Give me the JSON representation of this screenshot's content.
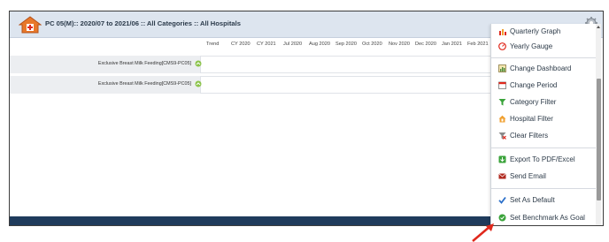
{
  "header": {
    "title": "PC 05(M):: 2020/07 to 2021/06 :: All Categories :: All Hospitals",
    "icon": "hospital-icon"
  },
  "table": {
    "columns": [
      "Trend",
      "CY 2020",
      "CY 2021",
      "Jul 2020",
      "Aug 2020",
      "Sep 2020",
      "Oct 2020",
      "Nov 2020",
      "Dec 2020",
      "Jan 2021",
      "Feb 2021"
    ],
    "rows": [
      {
        "label": "Exclusive Breast Milk Feeding[CMS9-PC05]"
      },
      {
        "label": "Exclusive Breast Milk Feeding[CMS9-PC05]"
      }
    ]
  },
  "menu": {
    "items": [
      {
        "label": "Quarterly Graph",
        "icon": "bar-chart-icon"
      },
      {
        "label": "Yearly Gauge",
        "icon": "gauge-icon"
      },
      {
        "label": "Change Dashboard",
        "icon": "dashboard-icon"
      },
      {
        "label": "Change Period",
        "icon": "calendar-icon"
      },
      {
        "label": "Category Filter",
        "icon": "filter-icon"
      },
      {
        "label": "Hospital Filter",
        "icon": "hospital-icon"
      },
      {
        "label": "Clear Filters",
        "icon": "clear-filter-icon"
      },
      {
        "label": "Export To PDF/Excel",
        "icon": "export-icon"
      },
      {
        "label": "Send Email",
        "icon": "email-icon"
      },
      {
        "label": "Set As Default",
        "icon": "checkmark-icon"
      },
      {
        "label": "Set Benchmark As Goal",
        "icon": "benchmark-icon"
      }
    ]
  },
  "colors": {
    "header_bg": "#dde5ef",
    "footer_bar": "#1f3b5c",
    "accent_red": "#e0281c"
  }
}
